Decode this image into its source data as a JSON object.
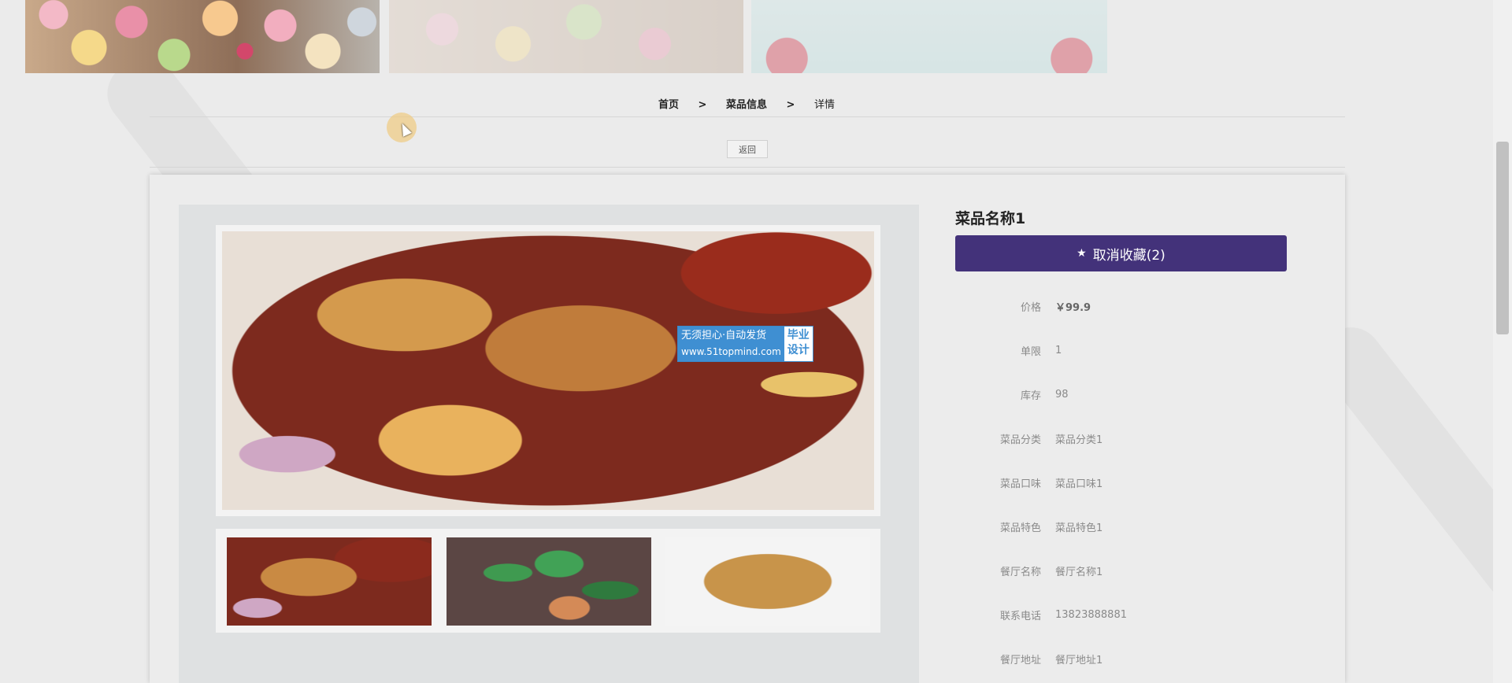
{
  "breadcrumb": {
    "home": "首页",
    "sep1": ">",
    "category": "菜品信息",
    "sep2": ">",
    "current": "详情"
  },
  "back_button": "返回",
  "dish": {
    "name": "菜品名称1",
    "favorite_button": "取消收藏(2)",
    "fields": [
      {
        "label": "价格",
        "value": "￥99.9"
      },
      {
        "label": "单限",
        "value": "1"
      },
      {
        "label": "库存",
        "value": "98"
      },
      {
        "label": "菜品分类",
        "value": "菜品分类1"
      },
      {
        "label": "菜品口味",
        "value": "菜品口味1"
      },
      {
        "label": "菜品特色",
        "value": "菜品特色1"
      },
      {
        "label": "餐厅名称",
        "value": "餐厅名称1"
      },
      {
        "label": "联系电话",
        "value": "13823888881"
      },
      {
        "label": "餐厅地址",
        "value": "餐厅地址1"
      }
    ]
  },
  "watermark": {
    "line1": "无须担心·自动发货",
    "line2": "www.51topmind.com",
    "side1": "毕业",
    "side2": "设计"
  },
  "icons": {
    "favorite": "star-icon"
  },
  "colors": {
    "accent": "#43327a",
    "background": "#ebebeb"
  }
}
